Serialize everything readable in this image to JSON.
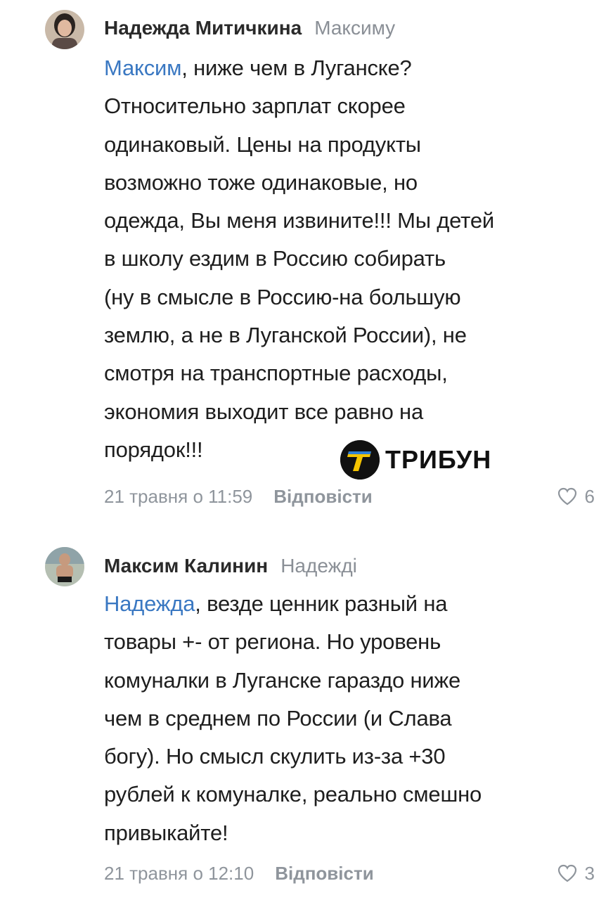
{
  "comments": [
    {
      "author": "Надежда Митичкина",
      "reply_to": "Максиму",
      "mention": "Максим",
      "text_lines": [
        ", ниже чем в Луганске?",
        "Относительно зарплат скорее",
        "одинаковый. Цены на продукты",
        "возможно тоже одинаковые, но",
        "одежда, Вы меня извините!!! Мы детей",
        "в школу ездим в Россию собирать",
        "(ну в смысле в Россию-на большую",
        "землю, а не в Луганской России), не",
        "смотря на транспортные расходы,",
        "экономия выходит все равно на",
        "порядок!!!"
      ],
      "timestamp": "21 травня о 11:59",
      "reply_label": "Відповісти",
      "likes": "6"
    },
    {
      "author": "Максим Калинин",
      "reply_to": "Надежді",
      "mention": "Надежда",
      "text_lines": [
        ", везде ценник разный на",
        "товары +- от региона. Но уровень",
        "комуналки в Луганске гараздо ниже",
        "чем в среднем по России (и Слава",
        "богу). Но смысл скулить из-за +30",
        "рублей к комуналке, реально смешно",
        "привыкайте!"
      ],
      "timestamp": "21 травня о 12:10",
      "reply_label": "Відповісти",
      "likes": "3"
    }
  ],
  "watermark": {
    "name": "ТРИБУН",
    "icon": "tribun-logo-icon"
  },
  "colors": {
    "mention": "#3a78c2",
    "meta": "#8f959c",
    "brand_yellow": "#f5c400",
    "brand_blue": "#2f7fd4"
  }
}
